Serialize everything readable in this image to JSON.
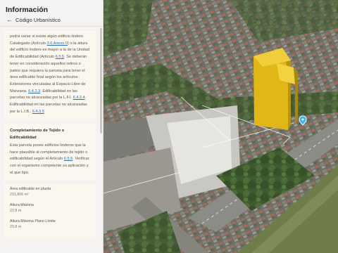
{
  "panel": {
    "title": "Información",
    "subtitle": "Código Urbanístico",
    "back_icon": "arrow-left-icon"
  },
  "card1": {
    "t1": "podrá variar si existe algún edificio lindero Catalogado (Artículo ",
    "l1": "3.6 Anexo II",
    "t2": ") o la altura del edificio lindero es mayor a la de la Unidad de Edificabilidad (Artículo ",
    "l2": "6.5.5",
    "t3": ". Se deberán tener en consideración aquellos retiros o patios que requiera la parcela para tener el área edificable final según los artículos . Extensiones vinculadas al Espacio Libre de Manzana. ",
    "l3": "6.4.2.3",
    "t4": ". Edificabilidad en las parcelas no alcanzadas por la L.F.I. ",
    "l4": "6.4.2.4",
    "t5": ". Edificabilidad en las parcelas no alcanzadas por la L.I.B.. ",
    "l5": "6.4.3.5"
  },
  "card2": {
    "title": "Completamiento de Tejido o Edificabilidad",
    "t1": "Esta parcela posee edificios linderos que la hace plausible al completamiento de tejido o edificabilidad según el Artículo ",
    "l1": "6.5.5",
    "t2": ". Verificar con el organismo competente su aplicación y el que tipo."
  },
  "data": [
    {
      "label": "Área edificable en planta",
      "value": "231,866 m²"
    },
    {
      "label": "Altura Máxima",
      "value": "22,8 m"
    },
    {
      "label": "Altura Máxima Plano Límite",
      "value": "29,8 m"
    }
  ],
  "map": {
    "building_color": "#e0b716",
    "marker_color": "#39b4e8"
  }
}
